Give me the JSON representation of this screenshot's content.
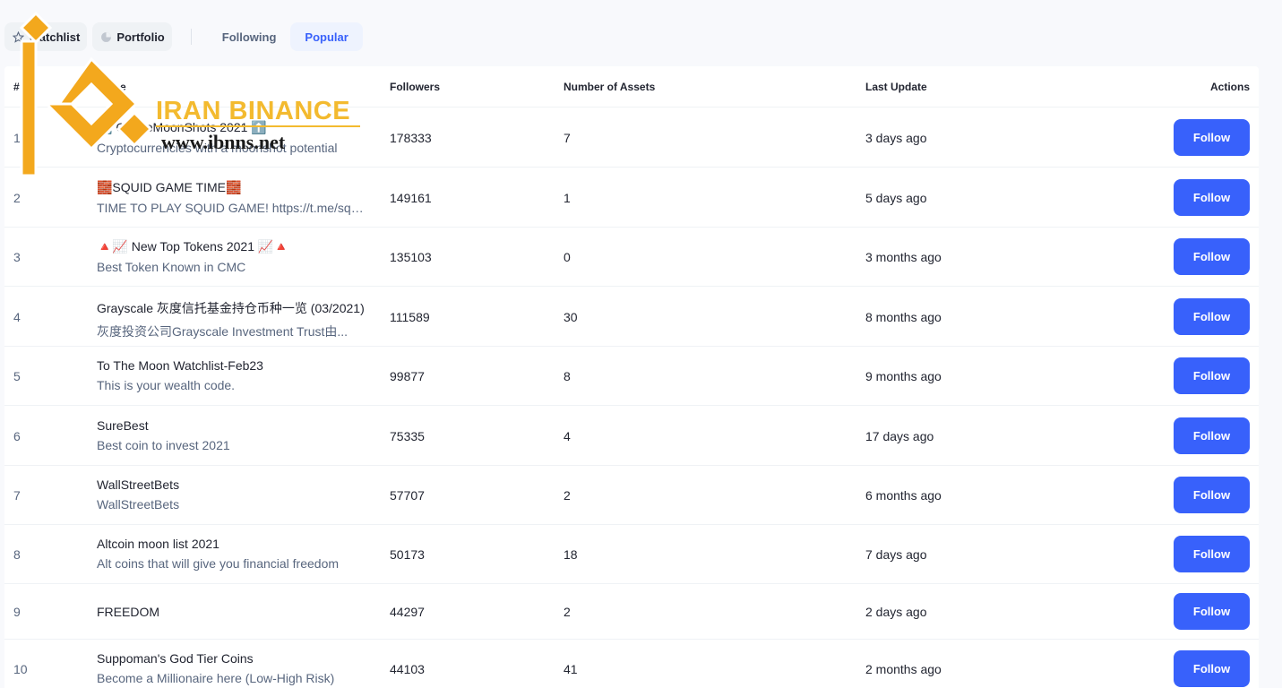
{
  "nav": {
    "watchlist_label": "Watchlist",
    "portfolio_label": "Portfolio",
    "tabs": [
      {
        "label": "Following",
        "active": false
      },
      {
        "label": "Popular",
        "active": true
      }
    ]
  },
  "table": {
    "headers": {
      "rank": "#",
      "name": "Name",
      "followers": "Followers",
      "assets": "Number of Assets",
      "last_update": "Last Update",
      "actions": "Actions"
    },
    "rows": [
      {
        "rank": "1",
        "title": "⬆️ CryptoMoonShots 2021 ⬆️",
        "desc": "Cryptocurrencies with a moonshot potential",
        "followers": "178333",
        "assets": "7",
        "updated": "3 days ago",
        "action": "Follow"
      },
      {
        "rank": "2",
        "title": "🧱SQUID GAME TIME🧱",
        "desc": "TIME TO PLAY SQUID GAME! https://t.me/squidgame",
        "followers": "149161",
        "assets": "1",
        "updated": "5 days ago",
        "action": "Follow"
      },
      {
        "rank": "3",
        "title": "🔺📈 New Top Tokens 2021 📈🔺",
        "desc": "Best Token Known in CMC",
        "followers": "135103",
        "assets": "0",
        "updated": "3 months ago",
        "action": "Follow"
      },
      {
        "rank": "4",
        "title": "Grayscale 灰度信托基金持仓币种一览 (03/2021)",
        "desc": "灰度投资公司Grayscale Investment Trust由...",
        "followers": "111589",
        "assets": "30",
        "updated": "8 months ago",
        "action": "Follow"
      },
      {
        "rank": "5",
        "title": "To The Moon Watchlist-Feb23",
        "desc": "This is your wealth code.",
        "followers": "99877",
        "assets": "8",
        "updated": "9 months ago",
        "action": "Follow"
      },
      {
        "rank": "6",
        "title": "SureBest",
        "desc": "Best coin to invest 2021",
        "followers": "75335",
        "assets": "4",
        "updated": "17 days ago",
        "action": "Follow"
      },
      {
        "rank": "7",
        "title": "WallStreetBets",
        "desc": "WallStreetBets",
        "followers": "57707",
        "assets": "2",
        "updated": "6 months ago",
        "action": "Follow"
      },
      {
        "rank": "8",
        "title": "Altcoin moon list 2021",
        "desc": "Alt coins that will give you financial freedom",
        "followers": "50173",
        "assets": "18",
        "updated": "7 days ago",
        "action": "Follow"
      },
      {
        "rank": "9",
        "title": "FREEDOM",
        "desc": "",
        "followers": "44297",
        "assets": "2",
        "updated": "2 days ago",
        "action": "Follow"
      },
      {
        "rank": "10",
        "title": "Suppoman's God Tier Coins",
        "desc": "Become a Millionaire here (Low-High Risk)",
        "followers": "44103",
        "assets": "41",
        "updated": "2 months ago",
        "action": "Follow"
      }
    ]
  },
  "watermark": {
    "brand": "IRAN BINANCE",
    "url": "www.ibnns.net"
  },
  "colors": {
    "accent": "#3861fb",
    "watermark": "#f3ba2f"
  }
}
